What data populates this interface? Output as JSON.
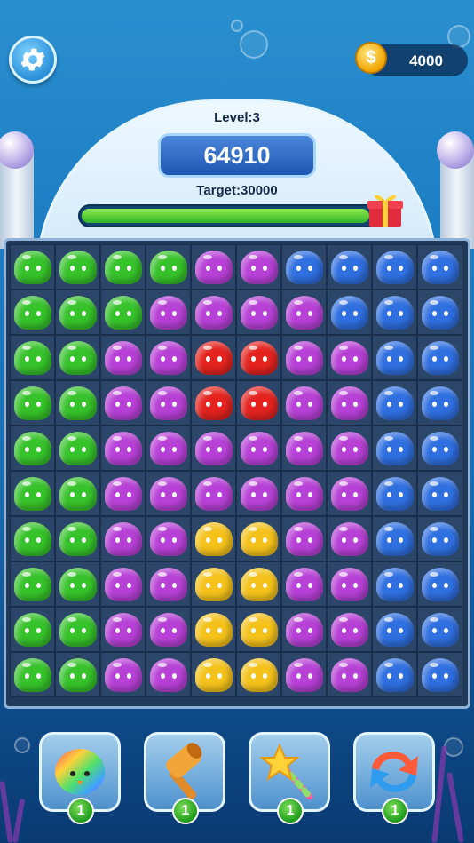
{
  "hud": {
    "coins": "4000",
    "coin_symbol": "$",
    "level_label": "Level:3",
    "score": "64910",
    "target_label": "Target:30000",
    "progress": 0.96
  },
  "colors": {
    "G": "#36c22a",
    "P": "#b740d6",
    "B": "#2f6fe0",
    "R": "#e4231f",
    "Y": "#f4c21a"
  },
  "board": {
    "rows": [
      [
        "G",
        "G",
        "G",
        "G",
        "P",
        "P",
        "B",
        "B",
        "B",
        "B"
      ],
      [
        "G",
        "G",
        "G",
        "P",
        "P",
        "P",
        "P",
        "B",
        "B",
        "B"
      ],
      [
        "G",
        "G",
        "P",
        "P",
        "R",
        "R",
        "P",
        "P",
        "B",
        "B"
      ],
      [
        "G",
        "G",
        "P",
        "P",
        "R",
        "R",
        "P",
        "P",
        "B",
        "B"
      ],
      [
        "G",
        "G",
        "P",
        "P",
        "P",
        "P",
        "P",
        "P",
        "B",
        "B"
      ],
      [
        "G",
        "G",
        "P",
        "P",
        "P",
        "P",
        "P",
        "P",
        "B",
        "B"
      ],
      [
        "G",
        "G",
        "P",
        "P",
        "Y",
        "Y",
        "P",
        "P",
        "B",
        "B"
      ],
      [
        "G",
        "G",
        "P",
        "P",
        "Y",
        "Y",
        "P",
        "P",
        "B",
        "B"
      ],
      [
        "G",
        "G",
        "P",
        "P",
        "Y",
        "Y",
        "P",
        "P",
        "B",
        "B"
      ],
      [
        "G",
        "G",
        "P",
        "P",
        "Y",
        "Y",
        "P",
        "P",
        "B",
        "B"
      ]
    ]
  },
  "boosters": [
    {
      "icon": "rainbow-octopus-icon",
      "count": "1"
    },
    {
      "icon": "hammer-icon",
      "count": "1"
    },
    {
      "icon": "magic-wand-icon",
      "count": "1"
    },
    {
      "icon": "shuffle-icon",
      "count": "1"
    }
  ]
}
